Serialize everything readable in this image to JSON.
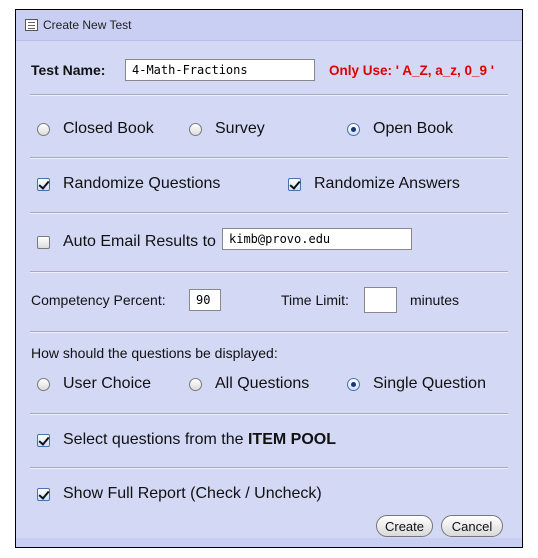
{
  "dialog": {
    "title": "Create New Test"
  },
  "test_name": {
    "label": "Test Name:",
    "value": "4-Math-Fractions",
    "hint": "Only Use: ' A_Z, a_z, 0_9 '"
  },
  "book_type": {
    "options": [
      "Closed Book",
      "Survey",
      "Open Book"
    ],
    "selected": "Open Book"
  },
  "randomize": {
    "questions": "Randomize Questions",
    "answers": "Randomize Answers"
  },
  "email": {
    "label": "Auto Email Results to",
    "value": "kimb@provo.edu"
  },
  "competency": {
    "label": "Competency Percent:",
    "value": "90"
  },
  "time_limit": {
    "label": "Time Limit:",
    "value": "",
    "unit": "minutes"
  },
  "display": {
    "question": "How should the questions be displayed:",
    "options": [
      "User Choice",
      "All Questions",
      "Single Question"
    ],
    "selected": "Single Question"
  },
  "item_pool": {
    "prefix": "Select questions from the ",
    "bold": "ITEM POOL"
  },
  "full_report": {
    "label": "Show Full Report (Check / Uncheck)"
  },
  "buttons": {
    "create": "Create",
    "cancel": "Cancel"
  }
}
